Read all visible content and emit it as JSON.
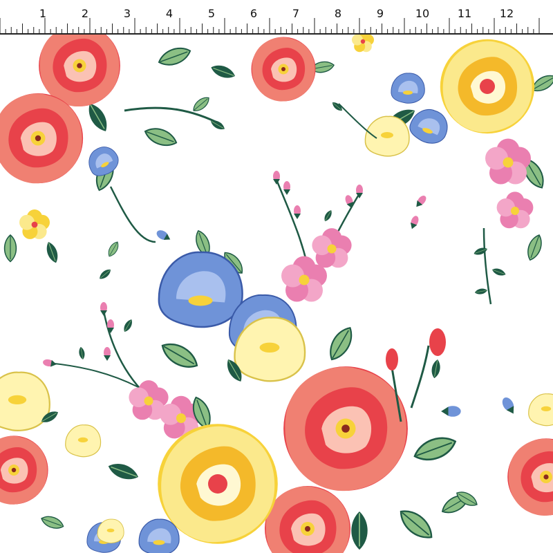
{
  "ruler": {
    "unit_labels": [
      "1",
      "2",
      "3",
      "4",
      "5",
      "6",
      "7",
      "8",
      "9",
      "10",
      "11",
      "12"
    ]
  },
  "fabric": {
    "pattern": "floral print",
    "background_color": "#ffffff",
    "colors": {
      "red_rose": "#e8424a",
      "coral_rose": "#f08072",
      "yellow_flower": "#f7d23a",
      "blue_flower": "#6f93d8",
      "pink_blossom": "#ea7fb0",
      "leaf_green": "#8bbf84",
      "leaf_dark": "#1f5a45"
    }
  }
}
